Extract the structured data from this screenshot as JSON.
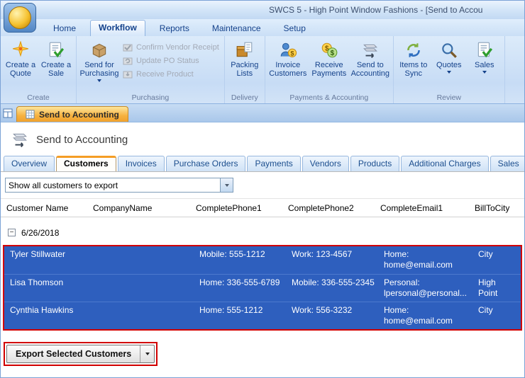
{
  "window": {
    "title": "SWCS 5 - High Point Window Fashions - [Send to Accou"
  },
  "colors": {
    "selection_blue": "#2e5fbe",
    "annotation_red": "#d10000",
    "active_doc_tab_orange": "#f6b13f",
    "ribbon_text_blue": "#15428b"
  },
  "ribbon": {
    "tabs": [
      "Home",
      "Workflow",
      "Reports",
      "Maintenance",
      "Setup"
    ],
    "active_tab": "Workflow",
    "groups": {
      "create": {
        "label": "Create",
        "buttons": [
          {
            "label": "Create a Quote",
            "icon": "star-quote"
          },
          {
            "label": "Create a Sale",
            "icon": "doc-check"
          }
        ]
      },
      "purchasing": {
        "label": "Purchasing",
        "main": {
          "label": "Send for Purchasing",
          "icon": "package",
          "has_dropdown": true
        },
        "disabled": [
          {
            "label": "Confirm Vendor Receipt",
            "icon": "box-check"
          },
          {
            "label": "Update PO Status",
            "icon": "box-refresh"
          },
          {
            "label": "Receive Product",
            "icon": "box-in"
          }
        ]
      },
      "delivery": {
        "label": "Delivery",
        "buttons": [
          {
            "label": "Packing Lists",
            "icon": "shipping-box"
          }
        ]
      },
      "payments": {
        "label": "Payments & Accounting",
        "buttons": [
          {
            "label": "Invoice Customers",
            "icon": "person-dollar"
          },
          {
            "label": "Receive Payments",
            "icon": "coins"
          },
          {
            "label": "Send to Accounting",
            "icon": "send-doc"
          }
        ]
      },
      "review": {
        "label": "Review",
        "buttons": [
          {
            "label": "Items to Sync",
            "icon": "sync-arrows"
          },
          {
            "label": "Quotes",
            "icon": "magnifier",
            "has_dropdown": true
          },
          {
            "label": "Sales",
            "icon": "doc-check",
            "has_dropdown": true
          }
        ]
      }
    }
  },
  "document_tab": {
    "label": "Send to Accounting",
    "icon": "spreadsheet"
  },
  "page": {
    "title": "Send to Accounting",
    "title_icon": "send-doc",
    "tabs": [
      "Overview",
      "Customers",
      "Invoices",
      "Purchase Orders",
      "Payments",
      "Vendors",
      "Products",
      "Additional Charges",
      "Sales"
    ],
    "active_tab": "Customers",
    "filter": {
      "value": "Show all customers to export"
    },
    "table": {
      "columns": [
        "Customer Name",
        "CompanyName",
        "CompletePhone1",
        "CompletePhone2",
        "CompleteEmail1",
        "BillToCity"
      ],
      "collapse_icon": "−",
      "group_label": "6/26/2018",
      "rows": [
        {
          "name": "Tyler Stillwater",
          "company": "",
          "phone1": "Mobile: 555-1212",
          "phone2": "Work: 123-4567",
          "email1": "Home: home@email.com",
          "city": "City"
        },
        {
          "name": "Lisa Thomson",
          "company": "",
          "phone1": "Home: 336-555-6789",
          "phone2": "Mobile: 336-555-2345",
          "email1": "Personal: lpersonal@personal...",
          "city": "High Point"
        },
        {
          "name": "Cynthia Hawkins",
          "company": "",
          "phone1": "Home: 555-1212",
          "phone2": "Work: 556-3232",
          "email1": "Home: home@email.com",
          "city": "City"
        }
      ]
    },
    "export_button": {
      "label": "Export Selected Customers",
      "has_dropdown": true
    }
  }
}
